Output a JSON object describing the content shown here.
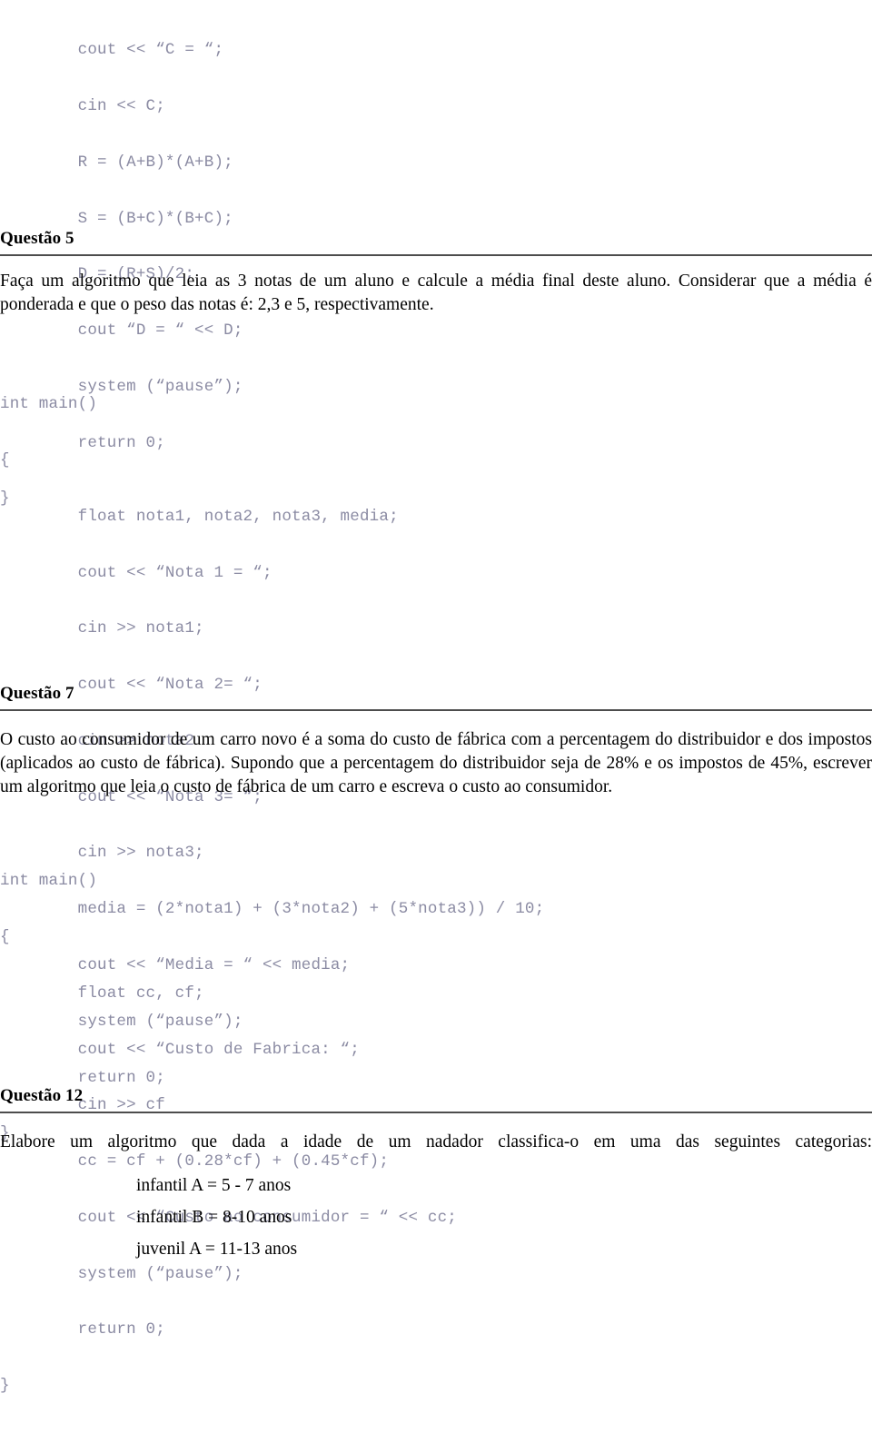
{
  "document": {
    "language": "pt-BR",
    "heading_rule_color": "#4d4d4d",
    "code_color": "#8b8ba3",
    "body_color": "#000000"
  },
  "code_block_top": {
    "lines": [
      "        cout << “C = “;",
      "        cin << C;",
      "        R = (A+B)*(A+B);",
      "        S = (B+C)*(B+C);",
      "        D = (R+S)/2;",
      "        cout “D = “ << D;",
      "        system (“pause”);",
      "        return 0;",
      "}"
    ]
  },
  "questao5": {
    "heading": "Questão 5",
    "body": "Faça um algoritmo que leia as 3 notas de um aluno e calcule a média final deste aluno. Considerar que a média é ponderada e que o peso das notas é: 2,3 e 5, respectivamente.",
    "code": {
      "lines": [
        "int main()",
        "{",
        "        float nota1, nota2, nota3, media;",
        "        cout << “Nota 1 = “;",
        "        cin >> nota1;",
        "        cout << “Nota 2= “;",
        "        cin >> nota2",
        "        cout << “Nota 3= “;",
        "        cin >> nota3;",
        "        media = (2*nota1) + (3*nota2) + (5*nota3)) / 10;",
        "        cout << “Media = “ << media;",
        "        system (“pause”);",
        "        return 0;",
        "}"
      ]
    }
  },
  "questao7": {
    "heading": "Questão 7",
    "body": "O custo ao consumidor de um carro novo é a soma do custo de fábrica com a percentagem do distribuidor e dos impostos (aplicados ao custo de fábrica). Supondo que a percentagem do distribuidor seja de 28% e os impostos de 45%, escrever um algoritmo que leia o custo de fábrica de um carro e escreva o custo ao consumidor.",
    "code": {
      "lines": [
        "int main()",
        "{",
        "        float cc, cf;",
        "        cout << “Custo de Fabrica: “;",
        "        cin >> cf",
        "        cc = cf + (0.28*cf) + (0.45*cf);",
        "        cout << “Custo ao consumidor = “ << cc;",
        "        system (“pause”);",
        "        return 0;",
        "}"
      ]
    }
  },
  "questao12": {
    "heading": "Questão 12",
    "body": "Elabore um algoritmo que dada a idade de um nadador classifica-o em uma das seguintes categorias:",
    "categories": [
      "infantil A = 5 - 7 anos",
      "infantil B = 8-10 anos",
      "juvenil A = 11-13 anos"
    ]
  }
}
